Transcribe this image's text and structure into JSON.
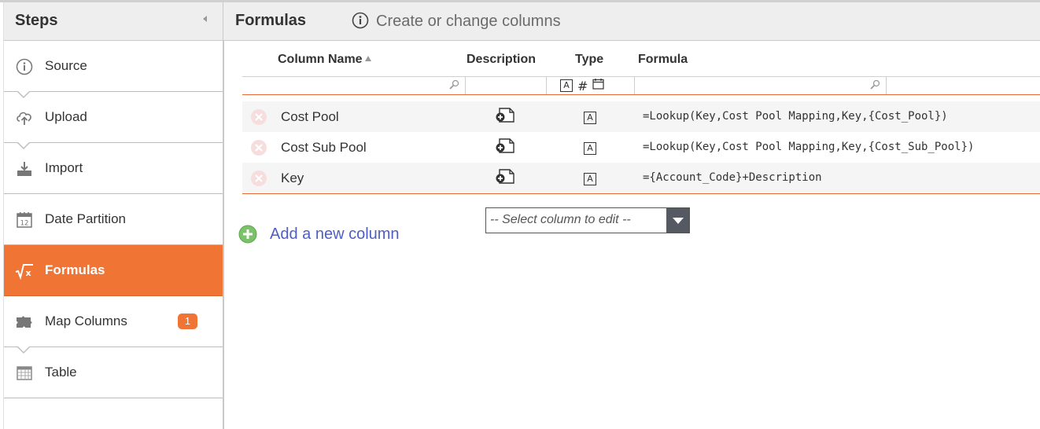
{
  "sidebar": {
    "title": "Steps",
    "steps": [
      {
        "label": "Source",
        "icon": "info-icon"
      },
      {
        "label": "Upload",
        "icon": "cloud-upload-icon"
      },
      {
        "label": "Import",
        "icon": "import-tray-icon"
      },
      {
        "label": "Date Partition",
        "icon": "calendar-icon"
      },
      {
        "label": "Formulas",
        "icon": "square-root-icon",
        "active": true
      },
      {
        "label": "Map Columns",
        "icon": "puzzle-icon",
        "badge": "1"
      },
      {
        "label": "Table",
        "icon": "table-grid-icon"
      }
    ]
  },
  "header": {
    "title": "Formulas",
    "subtitle": "Create or change columns"
  },
  "grid": {
    "columns": {
      "name": "Column Name",
      "description": "Description",
      "type": "Type",
      "formula": "Formula"
    },
    "rows": [
      {
        "name": "Cost Pool",
        "type": "text",
        "formula": "=Lookup(Key,Cost Pool Mapping,Key,{Cost_Pool})"
      },
      {
        "name": "Cost Sub Pool",
        "type": "text",
        "formula": "=Lookup(Key,Cost Pool Mapping,Key,{Cost_Sub_Pool})"
      },
      {
        "name": "Key",
        "type": "text",
        "formula": "={Account_Code}+Description"
      }
    ],
    "type_text_glyph": "A",
    "type_number_glyph": "#"
  },
  "actions": {
    "add_column_label": "Add a new column",
    "select_column_placeholder": "-- Select column to edit --"
  },
  "colors": {
    "accent": "#f07434",
    "link": "#4f5ec4",
    "add_green": "#7cc26b"
  }
}
